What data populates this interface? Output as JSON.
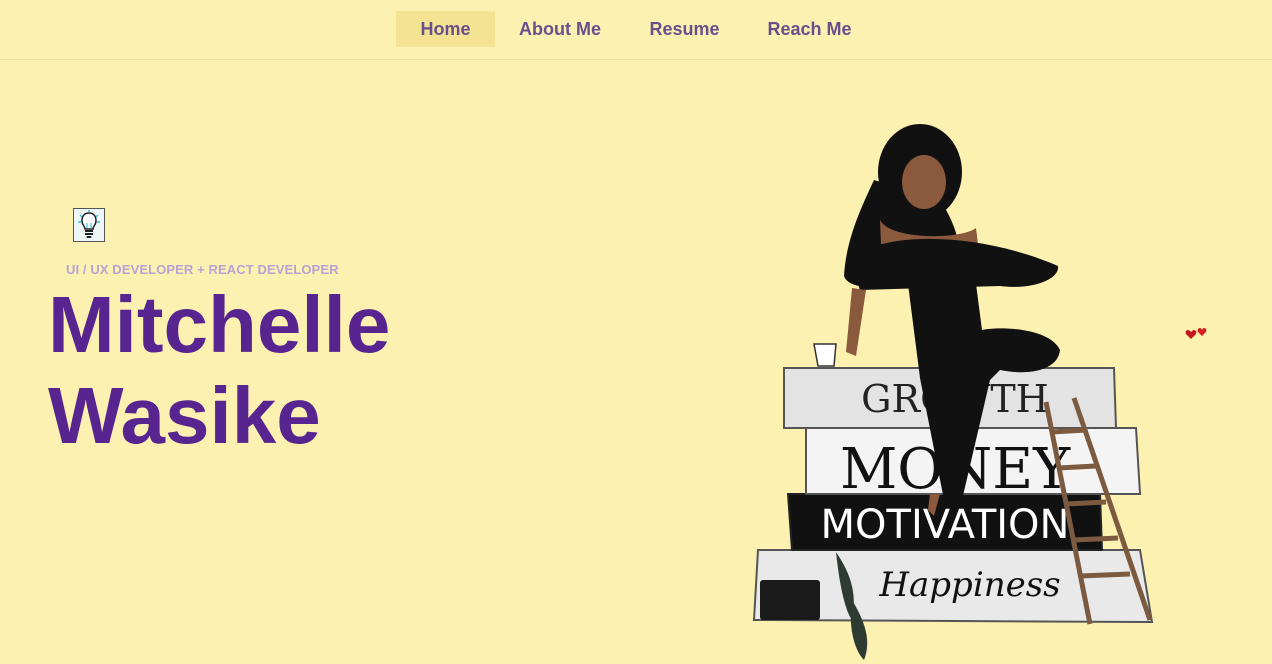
{
  "nav": {
    "items": [
      {
        "label": "Home",
        "active": true
      },
      {
        "label": "About Me",
        "active": false
      },
      {
        "label": "Resume",
        "active": false
      },
      {
        "label": "Reach Me",
        "active": false
      }
    ]
  },
  "hero": {
    "icon": "lightbulb-icon",
    "role": "UI / UX DEVELOPER + REACT DEVELOPER",
    "first_name": "Mitchelle",
    "last_name": "Wasike"
  },
  "illustration": {
    "books": [
      "GROWTH",
      "MONEY",
      "MOTIVATION",
      "Happiness"
    ]
  },
  "colors": {
    "background": "#fdf1b2",
    "nav_active": "#f5e394",
    "nav_text": "#6a4f8c",
    "role_text": "#b9a2d4",
    "name_text": "#58248f"
  }
}
